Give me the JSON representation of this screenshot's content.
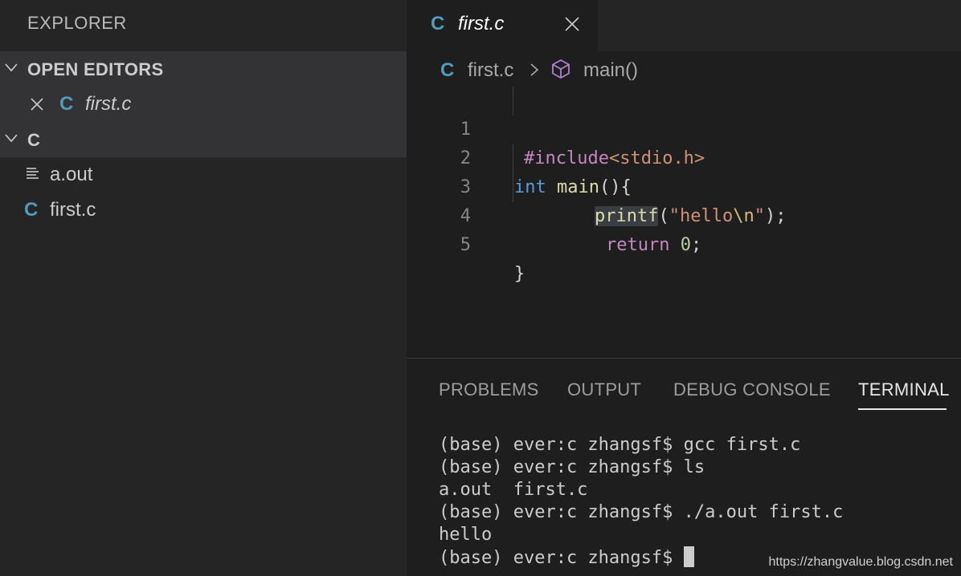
{
  "sidebar": {
    "title": "EXPLORER",
    "open_editors_label": "OPEN EDITORS",
    "open_editor_file": "first.c",
    "folder_label": "C",
    "files": [
      {
        "name": "a.out",
        "icon": "text-file-icon"
      },
      {
        "name": "first.c",
        "icon": "c-file-icon"
      }
    ]
  },
  "editor": {
    "tab_label": "first.c",
    "file_icon_letter": "C",
    "breadcrumb": {
      "file": "first.c",
      "symbol": "main()"
    },
    "line_numbers": [
      "1",
      "2",
      "3",
      "4",
      "5"
    ],
    "lines": [
      {
        "t1": "#include",
        "t2": "<stdio.h>"
      },
      {
        "t1": "int",
        "t2": " ",
        "t3": "main",
        "t4": "(){"
      },
      {
        "t1": "printf",
        "t2": "(",
        "t3": "\"hello",
        "t4": "\\n",
        "t5": "\"",
        "t6": ");"
      },
      {
        "t1": "return",
        "t2": " ",
        "t3": "0",
        "t4": ";"
      },
      {
        "t1": "}"
      }
    ]
  },
  "panel": {
    "tabs": [
      "PROBLEMS",
      "OUTPUT",
      "DEBUG CONSOLE",
      "TERMINAL"
    ],
    "active_tab": "TERMINAL",
    "terminal_lines": [
      "(base) ever:c zhangsf$ gcc first.c",
      "(base) ever:c zhangsf$ ls",
      "a.out  first.c",
      "(base) ever:c zhangsf$ ./a.out first.c",
      "hello",
      "(base) ever:c zhangsf$ "
    ]
  },
  "watermark": "https://zhangvalue.blog.csdn.net",
  "colors": {
    "accent_c_icon": "#519aba",
    "editor_bg": "#1e1e1e",
    "sidebar_bg": "#252526"
  }
}
